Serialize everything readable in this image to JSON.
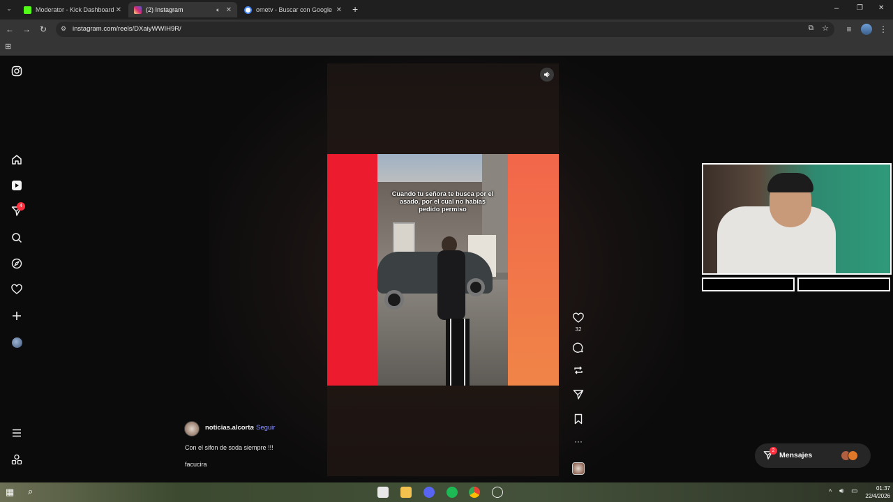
{
  "browser": {
    "tabs": [
      {
        "title": "Moderator - Kick Dashboard",
        "favicon_color": "#53fc18",
        "active": false
      },
      {
        "title": "(2) Instagram",
        "favicon_color": "#d62976",
        "active": true
      },
      {
        "title": "ometv - Buscar con Google",
        "favicon_color": "#4285f4",
        "active": false
      }
    ],
    "new_tab": "+",
    "url": "instagram.com/reels/DXaiyWWIH9R/",
    "window_controls": {
      "minimize": "–",
      "restore": "❐",
      "close": "✕"
    }
  },
  "sidebar": {
    "items": [
      {
        "name": "instagram-logo-icon",
        "glyph": "◎"
      },
      {
        "name": "home-icon",
        "glyph": "⌂"
      },
      {
        "name": "reels-icon",
        "glyph": "▶"
      },
      {
        "name": "messages-icon",
        "glyph": "➢",
        "badge": "4"
      },
      {
        "name": "search-icon",
        "glyph": "⌕"
      },
      {
        "name": "explore-icon",
        "glyph": "✧"
      },
      {
        "name": "notifications-heart-icon",
        "glyph": "♡"
      },
      {
        "name": "create-plus-icon",
        "glyph": "+"
      },
      {
        "name": "profile-avatar-icon",
        "glyph": "●"
      },
      {
        "name": "more-menu-icon",
        "glyph": "≡"
      },
      {
        "name": "also-from-meta-icon",
        "glyph": "⧉"
      }
    ]
  },
  "reel": {
    "overlay_caption": "Cuando tu señora te busca por el asado, por el cual no habías pedido permiso",
    "likes": "32",
    "author": "noticias.alcorta",
    "separator": "•",
    "follow_label": "Seguir",
    "caption": "Con el sifon de soda siempre !!!",
    "caption_extra": "facucira",
    "colors": {
      "left_bar": "#ec1c2e",
      "right_bar": "#f08548"
    }
  },
  "messages_button": {
    "label": "Mensajes",
    "badge": "2"
  },
  "taskbar": {
    "time": "01:37",
    "date": "22/4/2026"
  }
}
